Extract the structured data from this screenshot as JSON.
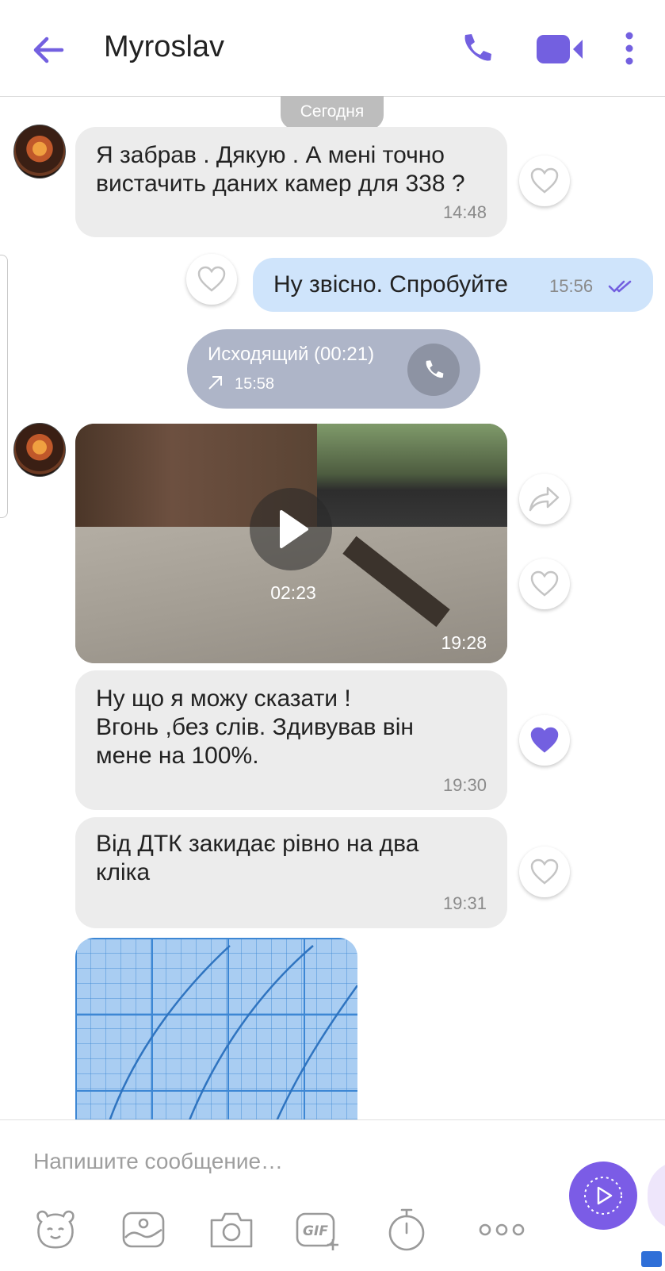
{
  "header": {
    "title": "Myroslav",
    "back_icon": "arrow-left-icon",
    "call_icon": "phone-icon",
    "video_icon": "video-camera-icon",
    "more_icon": "more-vertical-icon",
    "accent_color": "#7360e0"
  },
  "chat": {
    "date_separator": "Сегодня",
    "messages": [
      {
        "direction": "incoming",
        "text": "Я забрав . Дякую . А мені точно\nвистачить даних камер для 338 ?",
        "time": "14:48",
        "liked": false
      },
      {
        "direction": "outgoing",
        "text": "Ну звісно. Спробуйте",
        "time": "15:56",
        "status": "read",
        "liked": false
      },
      {
        "type": "call",
        "title": "Исходящий (00:21)",
        "time": "15:58"
      },
      {
        "direction": "incoming",
        "type": "video",
        "duration": "02:23",
        "time": "19:28",
        "liked": false
      },
      {
        "direction": "incoming",
        "text": "Ну що я можу сказати !\nВгонь ,без слів. Здивував він\nмене на 100%.",
        "time": "19:30",
        "liked": true
      },
      {
        "direction": "incoming",
        "text": "Від ДТК закидає рівно на два\nкліка",
        "time": "19:31",
        "liked": false
      },
      {
        "direction": "incoming",
        "type": "image"
      }
    ]
  },
  "composer": {
    "placeholder": "Напишите сообщение…",
    "tools": [
      "sticker-icon",
      "gallery-icon",
      "camera-icon",
      "gif-icon",
      "timer-icon",
      "more-horizontal-icon"
    ],
    "send_icon": "send-icon",
    "send_color": "#7b5ce6"
  }
}
